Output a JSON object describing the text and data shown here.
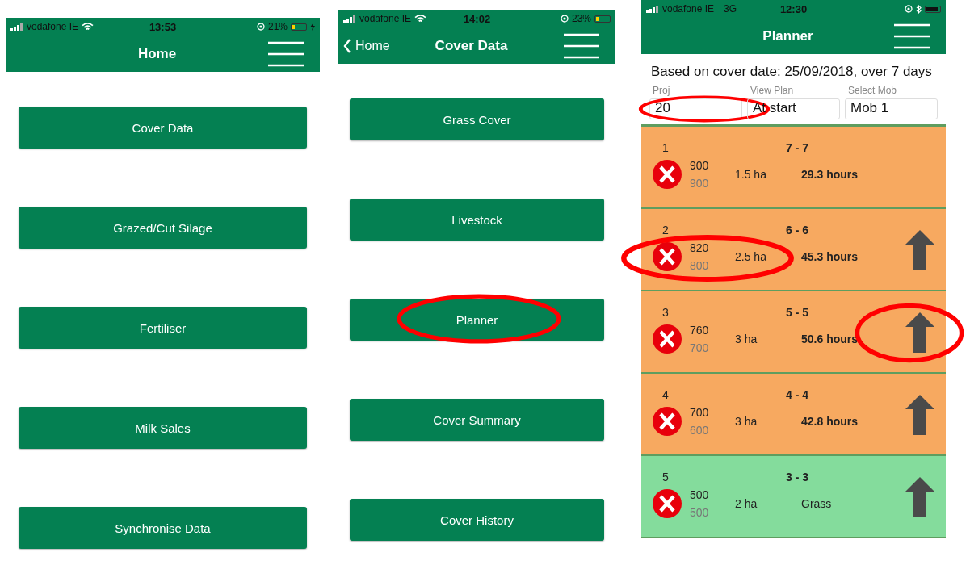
{
  "screens": [
    {
      "kind": "menu",
      "status": {
        "carrier": "vodafone IE",
        "wifi": true,
        "time": "13:53",
        "battery_text": "21%",
        "battery": {
          "level": 0.21
        },
        "charging": true
      },
      "header": {
        "title": "Home"
      },
      "buttons": [
        {
          "label": "Cover Data",
          "circled": false
        },
        {
          "label": "Grazed/Cut Silage",
          "circled": false
        },
        {
          "label": "Fertiliser",
          "circled": false
        },
        {
          "label": "Milk Sales",
          "circled": false
        },
        {
          "label": "Synchronise Data",
          "circled": false
        }
      ]
    },
    {
      "kind": "menu",
      "status": {
        "carrier": "vodafone IE",
        "wifi": true,
        "time": "14:02",
        "battery_text": "23%",
        "battery": {
          "level": 0.23
        }
      },
      "header": {
        "back": "Home",
        "title": "Cover Data"
      },
      "buttons": [
        {
          "label": "Grass Cover",
          "circled": false
        },
        {
          "label": "Livestock",
          "circled": false
        },
        {
          "label": "Planner",
          "circled": true
        },
        {
          "label": "Cover Summary",
          "circled": false
        },
        {
          "label": "Cover History",
          "circled": false
        }
      ]
    },
    {
      "kind": "planner",
      "status": {
        "carrier": "vodafone IE",
        "network": "3G",
        "time": "12:30",
        "battery": {
          "level": 0.9
        },
        "bluetooth": true
      },
      "header": {
        "title": "Planner"
      },
      "summary": "Based on cover date: 25/09/2018, over 7 days",
      "fields": [
        {
          "label": "Proj",
          "value": "20",
          "circled": true
        },
        {
          "label": "View Plan",
          "value": "At start",
          "circled": false
        },
        {
          "label": "Select Mob",
          "value": "Mob 1",
          "circled": false
        }
      ],
      "rows": [
        {
          "number": "1",
          "range": "7 - 7",
          "cover": "900",
          "target": "900",
          "area": "1.5 ha",
          "duration": "29.3 hours",
          "kind": "grazing",
          "color": "#f7a960",
          "arrow": false,
          "cover_circled": false,
          "arrow_circled": false
        },
        {
          "number": "2",
          "range": "6 - 6",
          "cover": "820",
          "target": "800",
          "area": "2.5 ha",
          "duration": "45.3 hours",
          "kind": "grazing",
          "color": "#f7a960",
          "arrow": true,
          "cover_circled": true,
          "arrow_circled": false
        },
        {
          "number": "3",
          "range": "5 - 5",
          "cover": "760",
          "target": "700",
          "area": "3 ha",
          "duration": "50.6 hours",
          "kind": "grazing",
          "color": "#f7a960",
          "arrow": true,
          "cover_circled": false,
          "arrow_circled": true
        },
        {
          "number": "4",
          "range": "4 - 4",
          "cover": "700",
          "target": "600",
          "area": "3 ha",
          "duration": "42.8 hours",
          "kind": "grazing",
          "color": "#f7a960",
          "arrow": true,
          "cover_circled": false,
          "arrow_circled": false
        },
        {
          "number": "5",
          "range": "3 - 3",
          "cover": "500",
          "target": "500",
          "area": "2 ha",
          "duration": "Grass",
          "kind": "grass",
          "color": "#84dc9c",
          "arrow": true,
          "cover_circled": false,
          "arrow_circled": false
        }
      ]
    }
  ]
}
